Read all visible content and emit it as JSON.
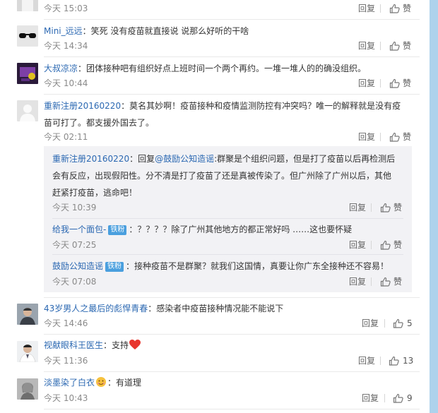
{
  "comments": [
    {
      "time": "今天 15:03",
      "reply": "回复",
      "avatar": "ghost-avatar"
    },
    {
      "name": "Mini_远远",
      "sep": "：",
      "text": "笑死 没有疫苗就直接说 说那么好听的干啥",
      "time": "今天 14:34",
      "reply": "回复",
      "avatar": "sunglasses-avatar"
    },
    {
      "name": "大叔凉凉",
      "sep": "：",
      "text": "团体接种吧有组织好点上班时间一个两个再约。一堆一堆人的的确没组织。",
      "time": "今天 10:44",
      "reply": "回复",
      "avatar": "purple-cartoon-avatar"
    },
    {
      "name": "重新注册20160220",
      "sep": "：",
      "text": "莫名其妙啊！疫苗接种和疫情监测防控有冲突吗？唯一的解释就是没有疫苗可打了。都支援外国去了。",
      "time": "今天 02:11",
      "reply": "回复",
      "avatar": "default-avatar"
    },
    {
      "name": "43岁男人之最后的彪悍青春",
      "sep": "：",
      "text": "感染者中疫苗接种情况能不能说下",
      "time": "今天 14:46",
      "reply": "回复",
      "likes": "5",
      "avatar": "man-photo-avatar"
    },
    {
      "name": "视献眼科王医生",
      "sep": "：",
      "text": "支持",
      "time": "今天 11:36",
      "reply": "回复",
      "likes": "13",
      "avatar": "doctor-avatar",
      "emoji": "heart-emoji"
    },
    {
      "name": "淡墨染了白衣",
      "sep": "：",
      "text": "有道理",
      "time": "今天 10:43",
      "reply": "回复",
      "likes": "9",
      "avatar": "bw-photo-avatar",
      "emoji": "smile-emoji"
    }
  ],
  "sub_comments": [
    {
      "name": "重新注册20160220",
      "sep": "：",
      "reply_prefix": "回复",
      "mention": "@鼓励公知造谣",
      "text": ":群聚是个组织问题，但是打了疫苗以后再检测后会有反应，出现假阳性。分不清是打了疫苗了还是真被传染了。但广州除了广州以后，其他赶紧打疫苗，逃命吧！",
      "time": "今天 10:39",
      "reply": "回复"
    },
    {
      "name": "给我一个面包-",
      "badge": "铁粉",
      "sep": "：",
      "text": "？？？？除了广州其他地方的都正常好吗 ……这也要怀疑",
      "time": "今天 07:25",
      "reply": "回复"
    },
    {
      "name": "鼓励公知造谣",
      "badge": "铁粉",
      "sep": "：",
      "text": "接种疫苗不是群聚？就我们这国情，真要让你广东全接种还不容易！",
      "time": "今天 07:08",
      "reply": "回复"
    }
  ],
  "colors": {
    "link": "#2b68b2",
    "badge": "#4a9fde",
    "time": "#8a8a8a",
    "heart": "#e8352d"
  }
}
